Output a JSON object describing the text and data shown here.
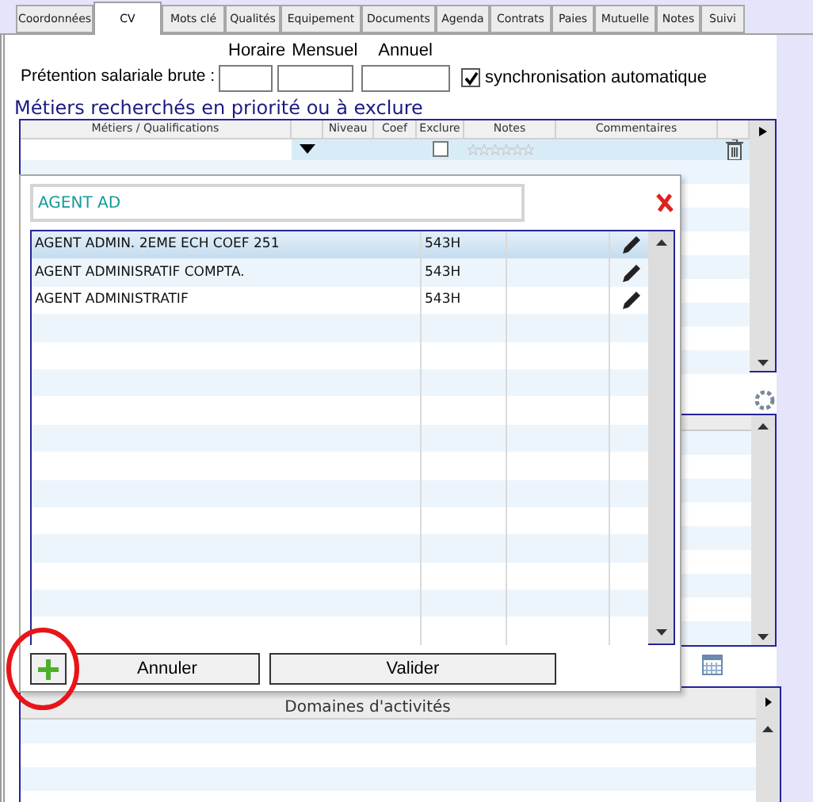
{
  "tabs": [
    {
      "label": "Coordonnées",
      "selected": false
    },
    {
      "label": "CV",
      "selected": true
    },
    {
      "label": "Mots clé",
      "selected": false
    },
    {
      "label": "Qualités",
      "selected": false
    },
    {
      "label": "Equipement",
      "selected": false
    },
    {
      "label": "Documents",
      "selected": false
    },
    {
      "label": "Agenda",
      "selected": false
    },
    {
      "label": "Contrats",
      "selected": false
    },
    {
      "label": "Paies",
      "selected": false
    },
    {
      "label": "Mutuelle",
      "selected": false
    },
    {
      "label": "Notes",
      "selected": false
    },
    {
      "label": "Suivi",
      "selected": false
    }
  ],
  "salary": {
    "label": "Prétention salariale brute :",
    "columns": [
      "Horaire",
      "Mensuel",
      "Annuel"
    ],
    "sync": {
      "label": "synchronisation automatique",
      "checked": true
    }
  },
  "jobs": {
    "title": "Métiers recherchés en priorité ou à exclure",
    "columns": [
      "Métiers / Qualifications",
      "",
      "Niveau",
      "Coef",
      "Exclure",
      "Notes",
      "Commentaires"
    ],
    "new_row": {
      "excluded": false,
      "stars": 0
    }
  },
  "domains": {
    "title": "Domaines d'activités"
  },
  "popup": {
    "search": {
      "value": "AGENT AD"
    },
    "results": [
      {
        "name": "AGENT ADMIN. 2EME ECH COEF 251",
        "code": "543H",
        "selected": true
      },
      {
        "name": "AGENT ADMINISRATIF COMPTA.",
        "code": "543H",
        "selected": false
      },
      {
        "name": "AGENT ADMINISTRATIF",
        "code": "543H",
        "selected": false
      }
    ],
    "buttons": [
      "Annuler",
      "Valider"
    ]
  }
}
